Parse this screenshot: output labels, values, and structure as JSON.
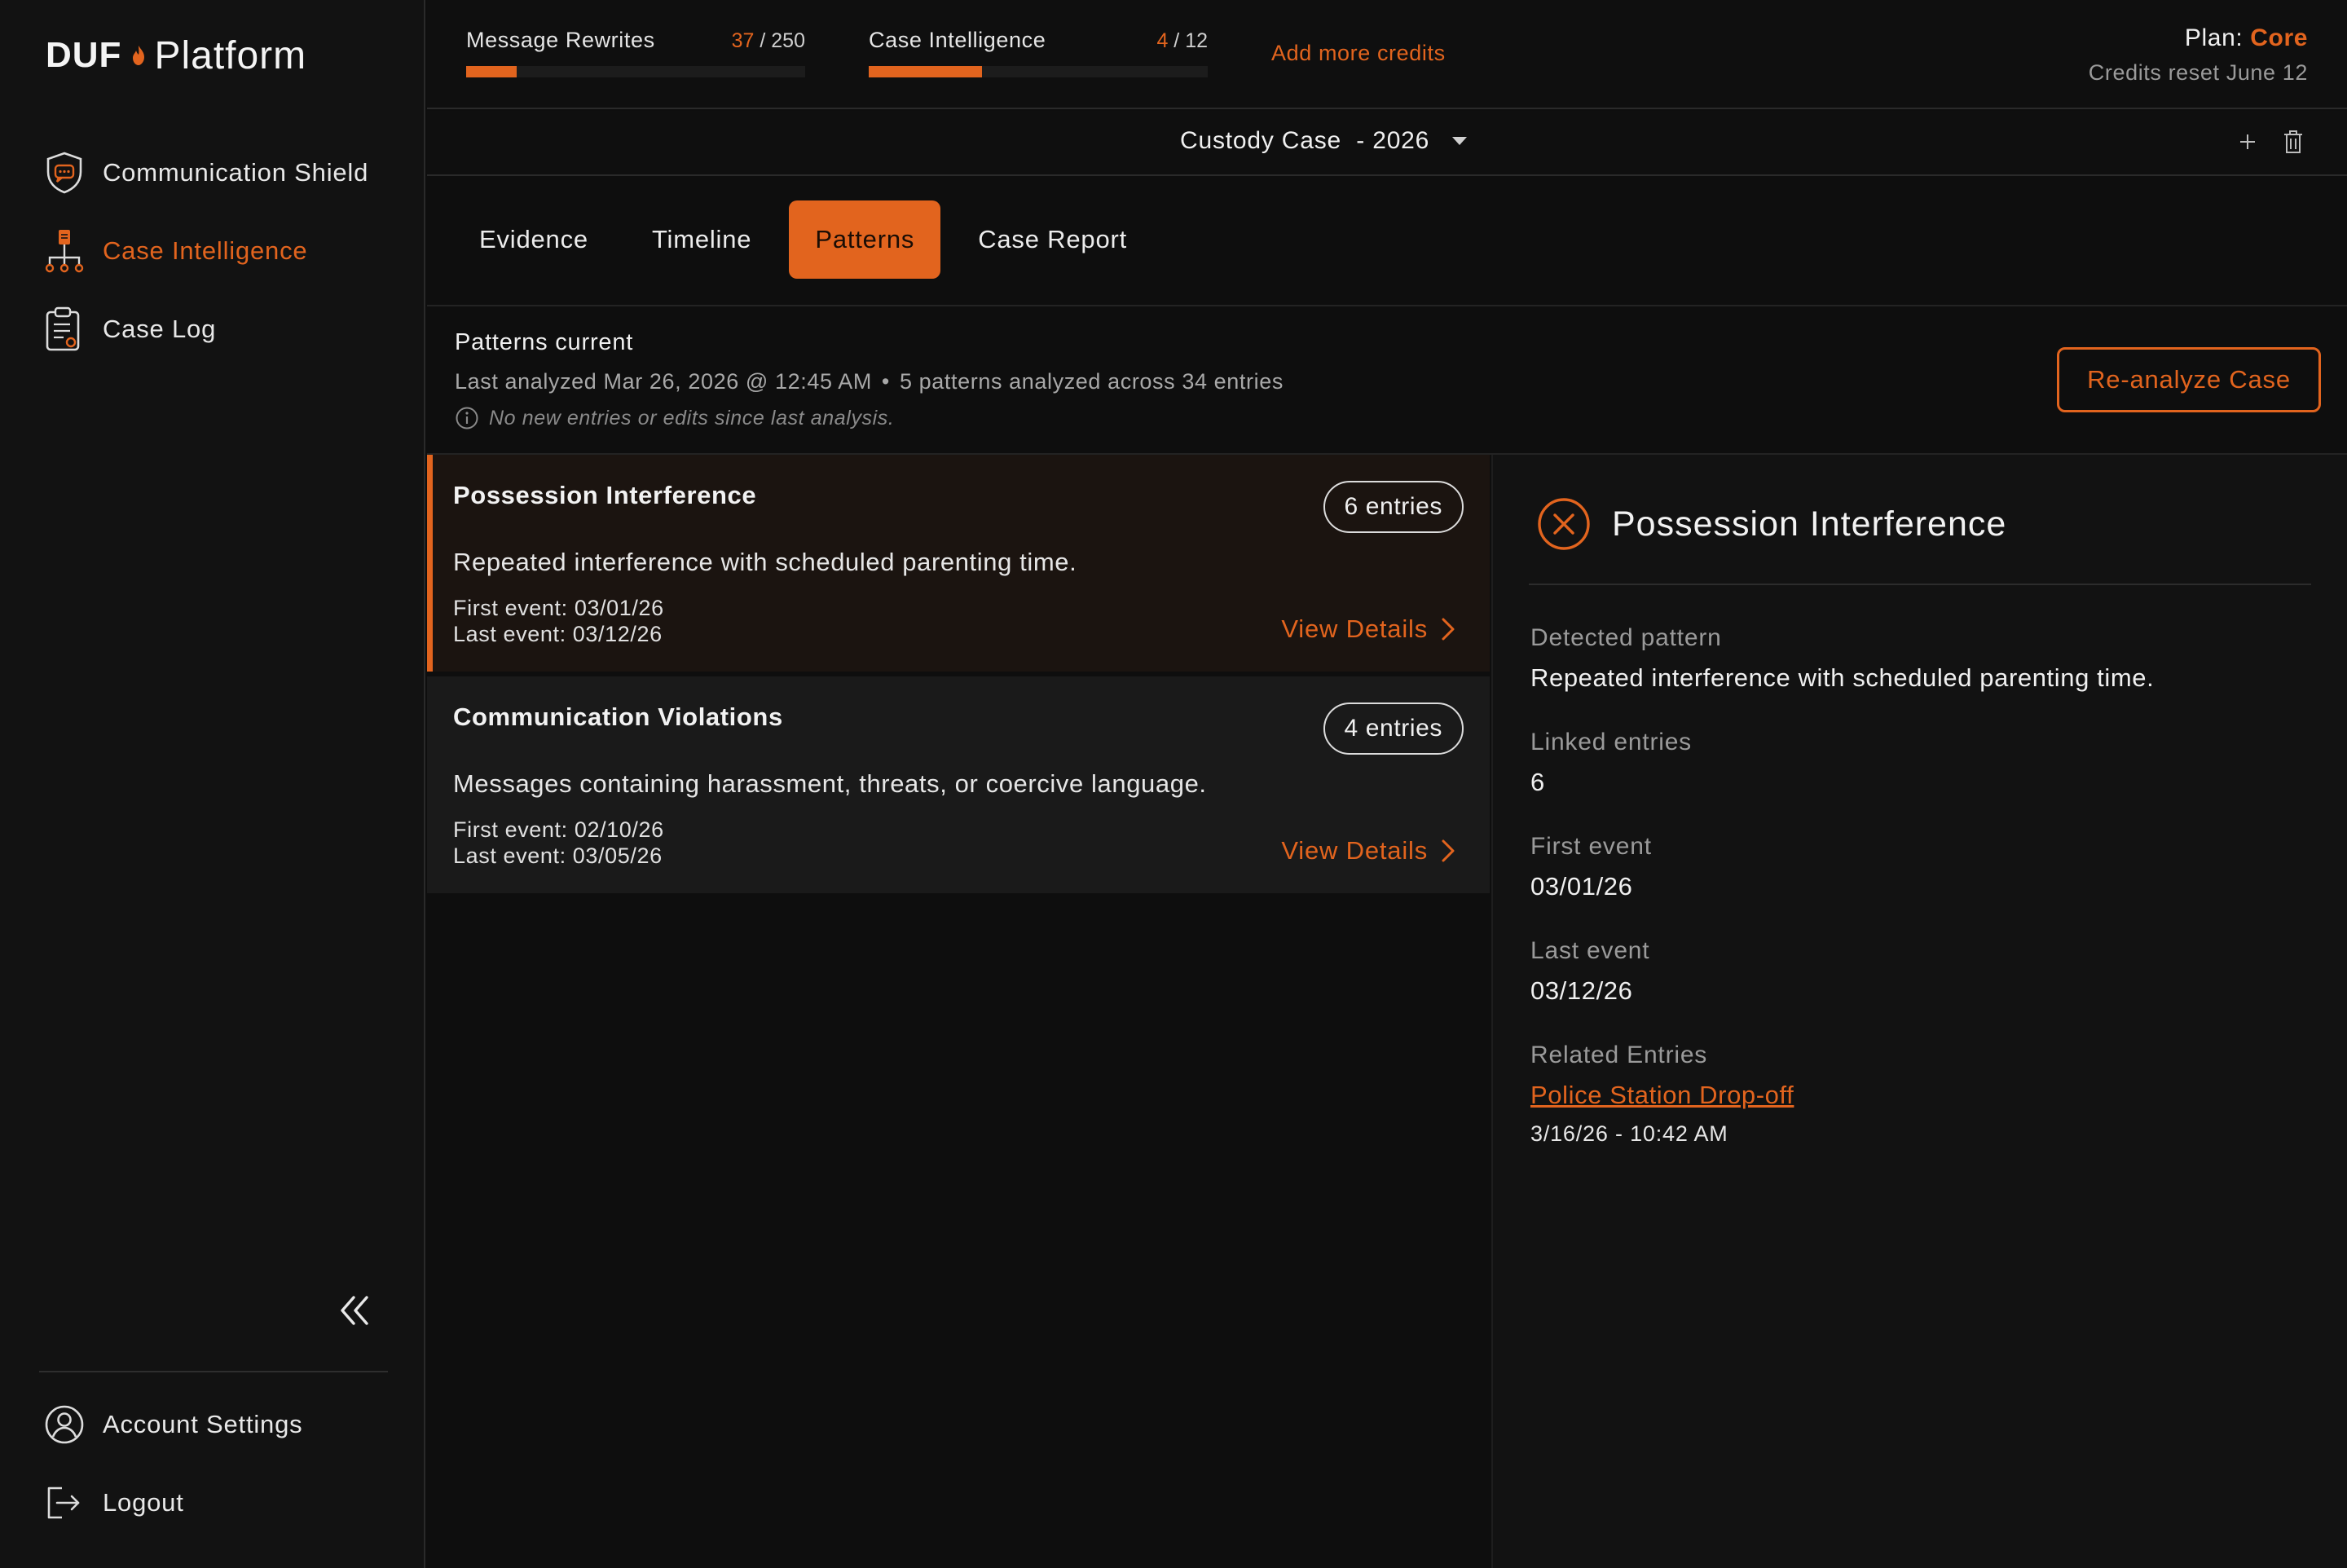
{
  "brand": {
    "name_bold": "DUF",
    "name_light": "Platform",
    "accent": "#e2641e"
  },
  "sidebar": {
    "items": [
      {
        "label": "Communication Shield",
        "icon": "shield-chat-icon",
        "active": false
      },
      {
        "label": "Case Intelligence",
        "icon": "org-chart-icon",
        "active": true
      },
      {
        "label": "Case Log",
        "icon": "clipboard-icon",
        "active": false
      }
    ],
    "bottom": [
      {
        "label": "Account Settings",
        "icon": "user-circle-icon"
      },
      {
        "label": "Logout",
        "icon": "logout-icon"
      }
    ],
    "collapse_icon": "double-chevron-left-icon"
  },
  "credits": [
    {
      "name": "Message Rewrites",
      "used": "37",
      "total": "/ 250",
      "fraction": 0.148
    },
    {
      "name": "Case Intelligence",
      "used": "4",
      "total": "/ 12",
      "fraction": 0.333
    }
  ],
  "add_credits": "Add more credits",
  "plan": {
    "prefix": "Plan:",
    "name": "Core",
    "reset": "Credits reset June 12"
  },
  "case_selector": {
    "value": "Custody Case  - 2026"
  },
  "tabs": [
    {
      "label": "Evidence",
      "active": false
    },
    {
      "label": "Timeline",
      "active": false
    },
    {
      "label": "Patterns",
      "active": true
    },
    {
      "label": "Case Report",
      "active": false
    }
  ],
  "status": {
    "title": "Patterns current",
    "last_analyzed": "Last analyzed Mar 26, 2026 @ 12:45 AM",
    "separator": "•",
    "summary": "5 patterns analyzed across 34 entries",
    "note": "No new entries or edits since last analysis.",
    "reanalyze_label": "Re-analyze Case"
  },
  "patterns": [
    {
      "name": "Possession Interference",
      "entries": "6 entries",
      "description": "Repeated interference with scheduled parenting time.",
      "first_event": "First event: 03/01/26",
      "last_event": "Last event: 03/12/26",
      "action": "View Details",
      "active": true
    },
    {
      "name": "Communication Violations",
      "entries": "4 entries",
      "description": "Messages containing harassment, threats, or coercive language.",
      "first_event": "First event: 02/10/26",
      "last_event": "Last event: 03/05/26",
      "action": "View Details",
      "active": false
    }
  ],
  "detail": {
    "title": "Possession Interference",
    "icon": "close-circle-icon",
    "detected_label": "Detected pattern",
    "detected_value": "Repeated interference with scheduled parenting time.",
    "linked_label": "Linked entries",
    "linked_value": "6",
    "first_label": "First event",
    "first_value": "03/01/26",
    "last_label": "Last event",
    "last_value": "03/12/26",
    "related_label": "Related Entries",
    "related_link": "Police Station Drop-off",
    "related_time": "3/16/26 - 10:42 AM"
  }
}
